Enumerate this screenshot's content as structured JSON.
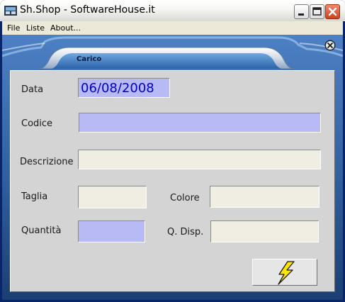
{
  "window": {
    "title": "Sh.Shop - SoftwareHouse.it"
  },
  "menu": {
    "items": [
      "File",
      "Liste",
      "About..."
    ]
  },
  "form": {
    "title": "Carico",
    "data_label": "Data",
    "data_value": "06/08/2008",
    "codice_label": "Codice",
    "codice_value": "",
    "descrizione_label": "Descrizione",
    "descrizione_value": "",
    "taglia_label": "Taglia",
    "taglia_value": "",
    "colore_label": "Colore",
    "colore_value": "",
    "quantita_label": "Quantità",
    "quantita_value": "",
    "qdisp_label": "Q. Disp.",
    "qdisp_value": ""
  },
  "colors": {
    "required_field": "#b8baf6",
    "readonly_field": "#f0eee2",
    "panel": "#d4d4d4",
    "mdi_blue": "#2f5f9f"
  },
  "icons": [
    "app-icon",
    "minimize-icon",
    "maximize-icon",
    "close-icon",
    "child-close-icon",
    "lightning-icon"
  ]
}
